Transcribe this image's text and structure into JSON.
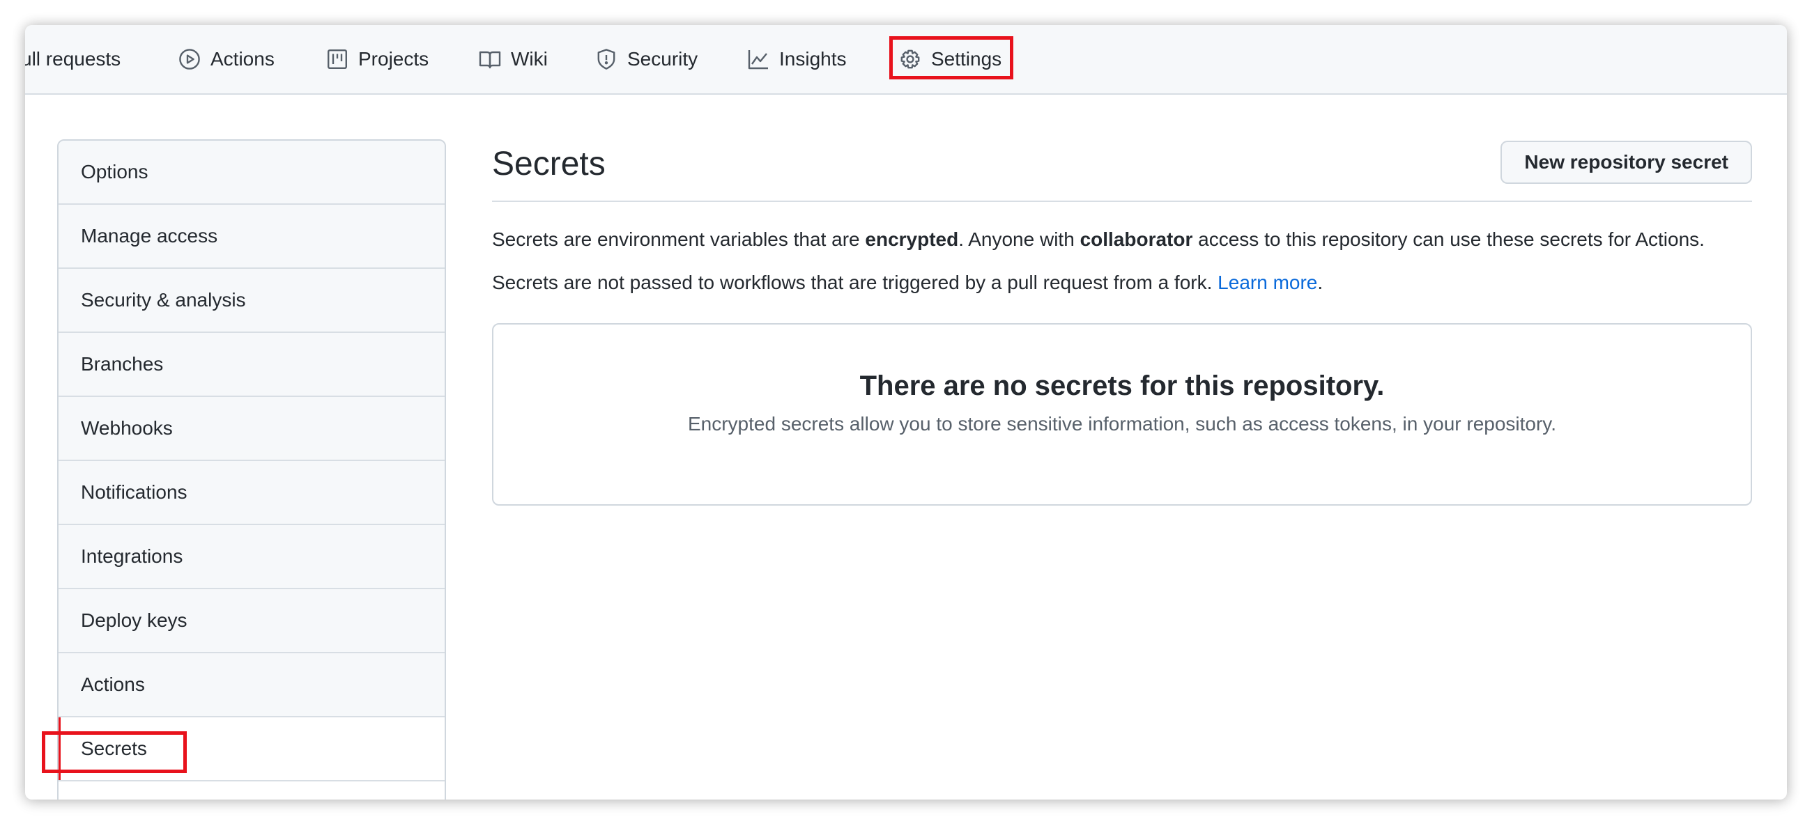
{
  "repo_nav": {
    "tabs": [
      {
        "label": "Pull requests",
        "icon": "git-pull-request-icon"
      },
      {
        "label": "Actions",
        "icon": "play-icon"
      },
      {
        "label": "Projects",
        "icon": "project-icon"
      },
      {
        "label": "Wiki",
        "icon": "book-icon"
      },
      {
        "label": "Security",
        "icon": "shield-icon"
      },
      {
        "label": "Insights",
        "icon": "graph-icon"
      },
      {
        "label": "Settings",
        "icon": "gear-icon"
      }
    ],
    "first_tab_visible_text": "ull requests"
  },
  "sidebar": {
    "items": [
      {
        "label": "Options"
      },
      {
        "label": "Manage access"
      },
      {
        "label": "Security & analysis"
      },
      {
        "label": "Branches"
      },
      {
        "label": "Webhooks"
      },
      {
        "label": "Notifications"
      },
      {
        "label": "Integrations"
      },
      {
        "label": "Deploy keys"
      },
      {
        "label": "Actions"
      },
      {
        "label": "Secrets"
      }
    ],
    "selected": "Secrets"
  },
  "main": {
    "title": "Secrets",
    "new_button_label": "New repository secret",
    "desc1": {
      "part1": "Secrets are environment variables that are ",
      "bold1": "encrypted",
      "part2": ". Anyone with ",
      "bold2": "collaborator",
      "part3": " access to this repository can use these secrets for Actions."
    },
    "desc2": {
      "text": "Secrets are not passed to workflows that are triggered by a pull request from a fork. ",
      "link": "Learn more",
      "end": "."
    },
    "empty": {
      "title": "There are no secrets for this repository.",
      "subtitle": "Encrypted secrets allow you to store sensitive information, such as access tokens, in your repository."
    }
  },
  "colors": {
    "highlight": "#e8121c",
    "link": "#0969da",
    "nav_background": "#f6f8fa"
  }
}
